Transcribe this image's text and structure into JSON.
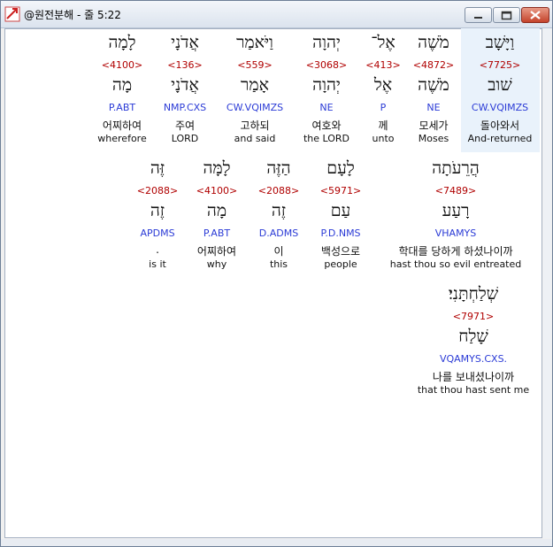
{
  "window": {
    "title": "@원전분해 - 줄 5:22",
    "app_icon": "diagonal-arrow-icon",
    "controls": [
      "minimize-icon",
      "maximize-icon",
      "close-icon"
    ],
    "close_color": "#c4432b"
  },
  "colors": {
    "strong": "#b00000",
    "morph": "#2b3bd6",
    "text": "#111111",
    "highlight": "#e9f2fb"
  },
  "lines": [
    {
      "words": [
        {
          "hebrew": "וַיָּשָׁב",
          "strong": "<7725>",
          "root": "שׁוב",
          "morph": "CW.VQIMZS",
          "korean": "돌아와서",
          "english": "And-returned",
          "highlighted": true
        },
        {
          "hebrew": "מֹשֶׁה",
          "strong": "<4872>",
          "root": "מֹשֶׁה",
          "morph": "NE",
          "korean": "모세가",
          "english": "Moses"
        },
        {
          "hebrew": "אֶל־",
          "strong": "<413>",
          "root": "אֶל",
          "morph": "P",
          "korean": "께",
          "english": "unto"
        },
        {
          "hebrew": "יְהוָה",
          "strong": "<3068>",
          "root": "יְהוָה",
          "morph": "NE",
          "korean": "여호와",
          "english": "the LORD"
        },
        {
          "hebrew": "וַיֹּאמַר",
          "strong": "<559>",
          "root": "אָמַר",
          "morph": "CW.VQIMZS",
          "korean": "고하되",
          "english": "and said"
        },
        {
          "hebrew": "אֲדֹנָי",
          "strong": "<136>",
          "root": "אֲדֹנָי",
          "morph": "NMP.CXS",
          "korean": "주여",
          "english": "LORD"
        },
        {
          "hebrew": "לָמָה",
          "strong": "<4100>",
          "root": "מָה",
          "morph": "P.ABT",
          "korean": "어찌하여",
          "english": "wherefore"
        }
      ]
    },
    {
      "words": [
        {
          "hebrew": "הֲרֵעֹתָה",
          "strong": "<7489>",
          "root": "רָעַע",
          "morph": "VHAMYS",
          "korean": "학대를 당하게 하셨나이까",
          "english": "hast thou so evil entreated"
        },
        {
          "hebrew": "לָעָם",
          "strong": "<5971>",
          "root": "עַם",
          "morph": "P.D.NMS",
          "korean": "백성으로",
          "english": "people"
        },
        {
          "hebrew": "הַזֶּה",
          "strong": "<2088>",
          "root": "זֶה",
          "morph": "D.ADMS",
          "korean": "이",
          "english": "this"
        },
        {
          "hebrew": "לָמָּה",
          "strong": "<4100>",
          "root": "מָה",
          "morph": "P.ABT",
          "korean": "어찌하여",
          "english": "why"
        },
        {
          "hebrew": "זֶּה",
          "strong": "<2088>",
          "root": "זֶה",
          "morph": "APDMS",
          "korean": ".",
          "english": "is it"
        }
      ]
    },
    {
      "words": [
        {
          "hebrew": "שְׁלַחְתָּנִי׃",
          "strong": "<7971>",
          "root": "שָׁלַח",
          "morph": "VQAMYS.CXS.",
          "korean": "나를 보내셨나이까",
          "english": "that thou hast sent me"
        }
      ]
    }
  ]
}
